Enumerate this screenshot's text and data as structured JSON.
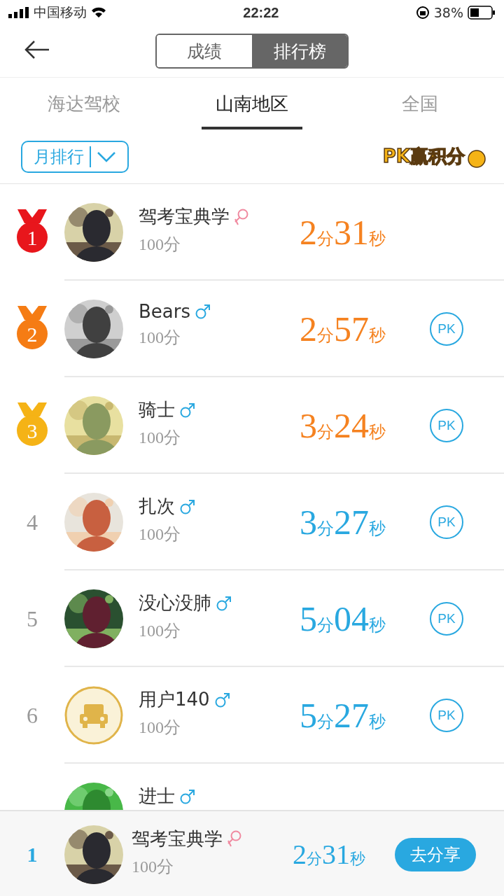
{
  "status_bar": {
    "carrier": "中国移动",
    "time": "22:22",
    "battery": "38%"
  },
  "header": {
    "segments": [
      {
        "label": "成绩",
        "selected": false
      },
      {
        "label": "排行榜",
        "selected": true
      }
    ]
  },
  "tabs": [
    {
      "label": "海达驾校",
      "selected": false
    },
    {
      "label": "山南地区",
      "selected": true
    },
    {
      "label": "全国",
      "selected": false
    }
  ],
  "filter": {
    "label": "月排行"
  },
  "promo": {
    "label": "PK赢积分"
  },
  "rows": [
    {
      "kind": "medal",
      "rank": "1",
      "color": "#e8161c",
      "name": "驾考宝典学",
      "female": true,
      "score": "100分",
      "time": {
        "text": "2分31秒",
        "color": "#f58220"
      }
    },
    {
      "kind": "medal",
      "rank": "2",
      "color": "#f57c14",
      "name": "Bears",
      "female": false,
      "score": "100分",
      "time": {
        "text": "2分57秒",
        "color": "#f58220"
      },
      "pk": "PK"
    },
    {
      "kind": "medal",
      "rank": "3",
      "color": "#f5b316",
      "name": "骑士",
      "female": false,
      "score": "100分",
      "time": {
        "text": "3分24秒",
        "color": "#f58220"
      },
      "pk": "PK"
    },
    {
      "kind": "plain",
      "rank": "4",
      "name": "扎次",
      "female": false,
      "score": "100分",
      "time": {
        "text": "3分27秒",
        "color": "#29a8e0"
      },
      "pk": "PK"
    },
    {
      "kind": "plain",
      "rank": "5",
      "name": "没心没肺",
      "female": false,
      "score": "100分",
      "time": {
        "text": "5分04秒",
        "color": "#29a8e0"
      },
      "pk": "PK"
    },
    {
      "kind": "plain",
      "rank": "6",
      "avatar": {
        "kind": "car"
      },
      "name": "用户140",
      "female": false,
      "score": "100分",
      "time": {
        "text": "5分27秒",
        "color": "#29a8e0"
      },
      "pk": "PK"
    },
    {
      "kind": "plain",
      "name": "进士",
      "female": false
    }
  ],
  "my_rank": {
    "rank": "1",
    "name": "驾考宝典学",
    "female": true,
    "score": "100分",
    "time": "2分31秒",
    "share": "去分享"
  }
}
